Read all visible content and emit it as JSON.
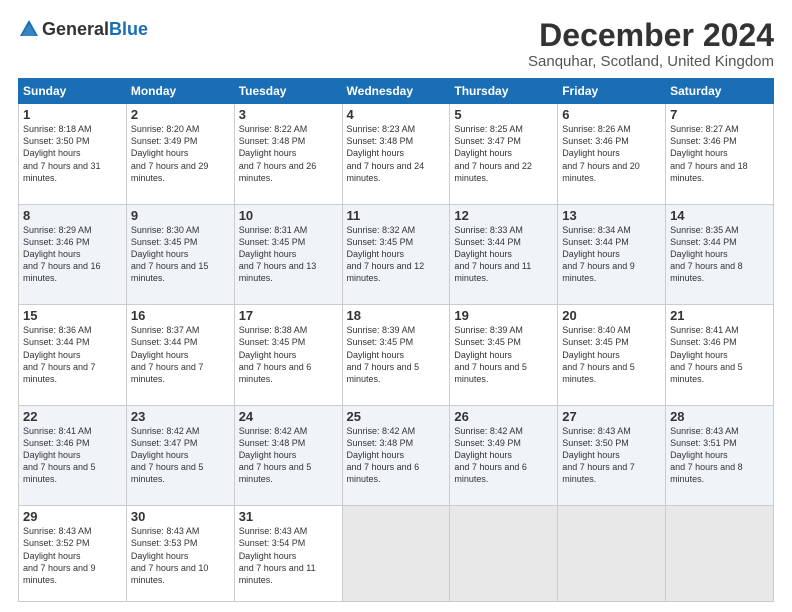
{
  "logo": {
    "general": "General",
    "blue": "Blue"
  },
  "title": "December 2024",
  "location": "Sanquhar, Scotland, United Kingdom",
  "days_of_week": [
    "Sunday",
    "Monday",
    "Tuesday",
    "Wednesday",
    "Thursday",
    "Friday",
    "Saturday"
  ],
  "weeks": [
    [
      {
        "day": "1",
        "sunrise": "8:18 AM",
        "sunset": "3:50 PM",
        "daylight": "7 hours and 31 minutes."
      },
      {
        "day": "2",
        "sunrise": "8:20 AM",
        "sunset": "3:49 PM",
        "daylight": "7 hours and 29 minutes."
      },
      {
        "day": "3",
        "sunrise": "8:22 AM",
        "sunset": "3:48 PM",
        "daylight": "7 hours and 26 minutes."
      },
      {
        "day": "4",
        "sunrise": "8:23 AM",
        "sunset": "3:48 PM",
        "daylight": "7 hours and 24 minutes."
      },
      {
        "day": "5",
        "sunrise": "8:25 AM",
        "sunset": "3:47 PM",
        "daylight": "7 hours and 22 minutes."
      },
      {
        "day": "6",
        "sunrise": "8:26 AM",
        "sunset": "3:46 PM",
        "daylight": "7 hours and 20 minutes."
      },
      {
        "day": "7",
        "sunrise": "8:27 AM",
        "sunset": "3:46 PM",
        "daylight": "7 hours and 18 minutes."
      }
    ],
    [
      {
        "day": "8",
        "sunrise": "8:29 AM",
        "sunset": "3:46 PM",
        "daylight": "7 hours and 16 minutes."
      },
      {
        "day": "9",
        "sunrise": "8:30 AM",
        "sunset": "3:45 PM",
        "daylight": "7 hours and 15 minutes."
      },
      {
        "day": "10",
        "sunrise": "8:31 AM",
        "sunset": "3:45 PM",
        "daylight": "7 hours and 13 minutes."
      },
      {
        "day": "11",
        "sunrise": "8:32 AM",
        "sunset": "3:45 PM",
        "daylight": "7 hours and 12 minutes."
      },
      {
        "day": "12",
        "sunrise": "8:33 AM",
        "sunset": "3:44 PM",
        "daylight": "7 hours and 11 minutes."
      },
      {
        "day": "13",
        "sunrise": "8:34 AM",
        "sunset": "3:44 PM",
        "daylight": "7 hours and 9 minutes."
      },
      {
        "day": "14",
        "sunrise": "8:35 AM",
        "sunset": "3:44 PM",
        "daylight": "7 hours and 8 minutes."
      }
    ],
    [
      {
        "day": "15",
        "sunrise": "8:36 AM",
        "sunset": "3:44 PM",
        "daylight": "7 hours and 7 minutes."
      },
      {
        "day": "16",
        "sunrise": "8:37 AM",
        "sunset": "3:44 PM",
        "daylight": "7 hours and 7 minutes."
      },
      {
        "day": "17",
        "sunrise": "8:38 AM",
        "sunset": "3:45 PM",
        "daylight": "7 hours and 6 minutes."
      },
      {
        "day": "18",
        "sunrise": "8:39 AM",
        "sunset": "3:45 PM",
        "daylight": "7 hours and 5 minutes."
      },
      {
        "day": "19",
        "sunrise": "8:39 AM",
        "sunset": "3:45 PM",
        "daylight": "7 hours and 5 minutes."
      },
      {
        "day": "20",
        "sunrise": "8:40 AM",
        "sunset": "3:45 PM",
        "daylight": "7 hours and 5 minutes."
      },
      {
        "day": "21",
        "sunrise": "8:41 AM",
        "sunset": "3:46 PM",
        "daylight": "7 hours and 5 minutes."
      }
    ],
    [
      {
        "day": "22",
        "sunrise": "8:41 AM",
        "sunset": "3:46 PM",
        "daylight": "7 hours and 5 minutes."
      },
      {
        "day": "23",
        "sunrise": "8:42 AM",
        "sunset": "3:47 PM",
        "daylight": "7 hours and 5 minutes."
      },
      {
        "day": "24",
        "sunrise": "8:42 AM",
        "sunset": "3:48 PM",
        "daylight": "7 hours and 5 minutes."
      },
      {
        "day": "25",
        "sunrise": "8:42 AM",
        "sunset": "3:48 PM",
        "daylight": "7 hours and 6 minutes."
      },
      {
        "day": "26",
        "sunrise": "8:42 AM",
        "sunset": "3:49 PM",
        "daylight": "7 hours and 6 minutes."
      },
      {
        "day": "27",
        "sunrise": "8:43 AM",
        "sunset": "3:50 PM",
        "daylight": "7 hours and 7 minutes."
      },
      {
        "day": "28",
        "sunrise": "8:43 AM",
        "sunset": "3:51 PM",
        "daylight": "7 hours and 8 minutes."
      }
    ],
    [
      {
        "day": "29",
        "sunrise": "8:43 AM",
        "sunset": "3:52 PM",
        "daylight": "7 hours and 9 minutes."
      },
      {
        "day": "30",
        "sunrise": "8:43 AM",
        "sunset": "3:53 PM",
        "daylight": "7 hours and 10 minutes."
      },
      {
        "day": "31",
        "sunrise": "8:43 AM",
        "sunset": "3:54 PM",
        "daylight": "7 hours and 11 minutes."
      },
      null,
      null,
      null,
      null
    ]
  ]
}
